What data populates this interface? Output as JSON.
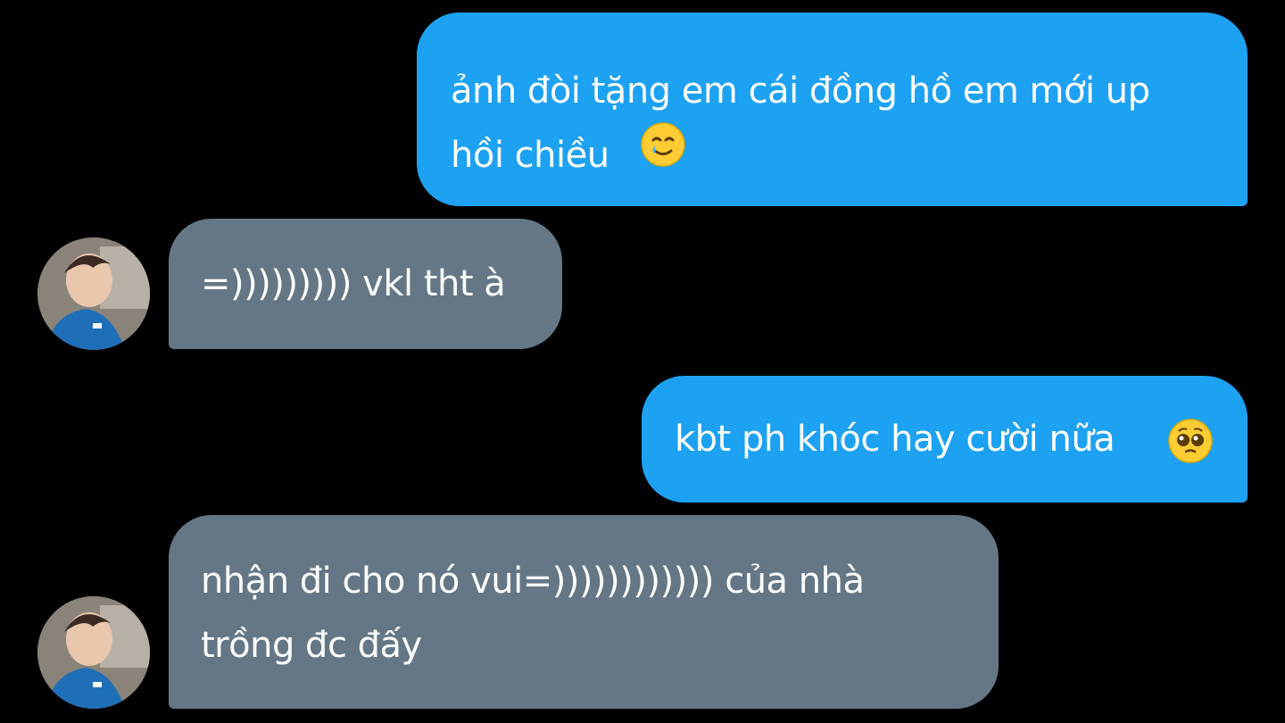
{
  "colors": {
    "background": "#000000",
    "outgoing_bubble": "#1da1f2",
    "incoming_bubble": "#657786",
    "text": "#ffffff"
  },
  "messages": [
    {
      "direction": "outgoing",
      "text": "ảnh đòi tặng em cái đồng hồ em mới up\nhồi chiều",
      "emoji": "smiling-face-with-tear-icon"
    },
    {
      "direction": "incoming",
      "text": "=))))))))) vkl tht à",
      "avatar": "avatar"
    },
    {
      "direction": "outgoing",
      "text": "kbt ph khóc hay cười nữa",
      "emoji": "pleading-face-icon"
    },
    {
      "direction": "incoming",
      "text": "nhận đi cho nó vui=)))))))))))) của nhà\ntrồng đc đấy",
      "avatar": "avatar"
    }
  ]
}
